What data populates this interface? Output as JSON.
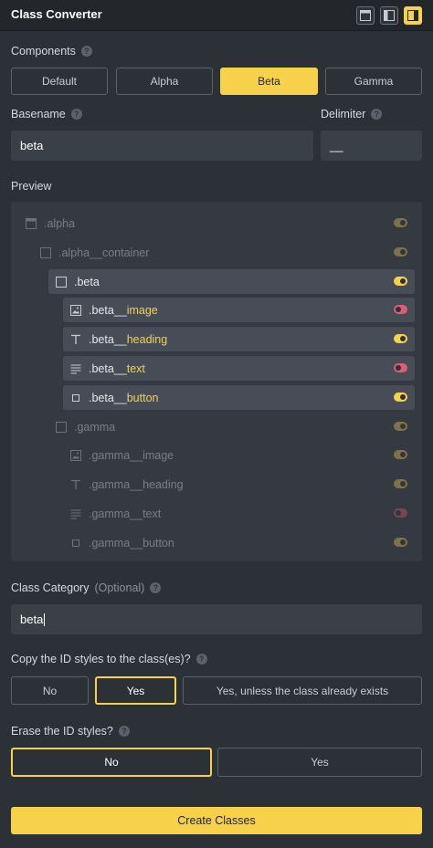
{
  "window": {
    "title": "Class Converter",
    "buttons": [
      "window-icon",
      "sidebar-left-icon",
      "sidebar-right-icon"
    ]
  },
  "components": {
    "label": "Components",
    "options": [
      "Default",
      "Alpha",
      "Beta",
      "Gamma"
    ],
    "selected": "Beta"
  },
  "basename": {
    "label": "Basename",
    "value": "beta"
  },
  "delimiter": {
    "label": "Delimiter",
    "value": "__"
  },
  "preview": {
    "label": "Preview",
    "rows": [
      {
        "prefix": ".alpha",
        "suffix": "",
        "icon": "container-icon",
        "toggle": "on",
        "state": "dim"
      },
      {
        "prefix": ".alpha__container",
        "suffix": "",
        "icon": "square-icon",
        "toggle": "on",
        "state": "dim"
      },
      {
        "prefix": ".beta",
        "suffix": "",
        "icon": "square-icon",
        "toggle": "on",
        "state": "active"
      },
      {
        "prefix": ".beta__",
        "suffix": "image",
        "icon": "image-icon",
        "toggle": "off",
        "state": "active"
      },
      {
        "prefix": ".beta__",
        "suffix": "heading",
        "icon": "text-icon",
        "toggle": "on",
        "state": "active"
      },
      {
        "prefix": ".beta__",
        "suffix": "text",
        "icon": "paragraph-icon",
        "toggle": "off",
        "state": "active"
      },
      {
        "prefix": ".beta__",
        "suffix": "button",
        "icon": "button-icon",
        "toggle": "on",
        "state": "active"
      },
      {
        "prefix": ".gamma",
        "suffix": "",
        "icon": "square-icon",
        "toggle": "on",
        "state": "dim"
      },
      {
        "prefix": ".gamma__",
        "suffix": "image",
        "icon": "image-icon",
        "toggle": "on",
        "state": "dim"
      },
      {
        "prefix": ".gamma__",
        "suffix": "heading",
        "icon": "text-icon",
        "toggle": "on",
        "state": "dim"
      },
      {
        "prefix": ".gamma__",
        "suffix": "text",
        "icon": "paragraph-icon",
        "toggle": "off",
        "state": "dim"
      },
      {
        "prefix": ".gamma__",
        "suffix": "button",
        "icon": "button-icon",
        "toggle": "on",
        "state": "dim"
      }
    ]
  },
  "category": {
    "label": "Class Category",
    "optional": "(Optional)",
    "value": "beta"
  },
  "copy_styles": {
    "label": "Copy the ID styles to the class(es)?",
    "options": [
      "No",
      "Yes",
      "Yes, unless the class already exists"
    ],
    "selected": "Yes"
  },
  "erase_styles": {
    "label": "Erase the ID styles?",
    "options": [
      "No",
      "Yes"
    ],
    "selected": "No"
  },
  "submit": {
    "label": "Create Classes"
  },
  "colors": {
    "accent": "#f7d14a",
    "toggle_off": "#e05b75",
    "background": "#2c3138"
  }
}
